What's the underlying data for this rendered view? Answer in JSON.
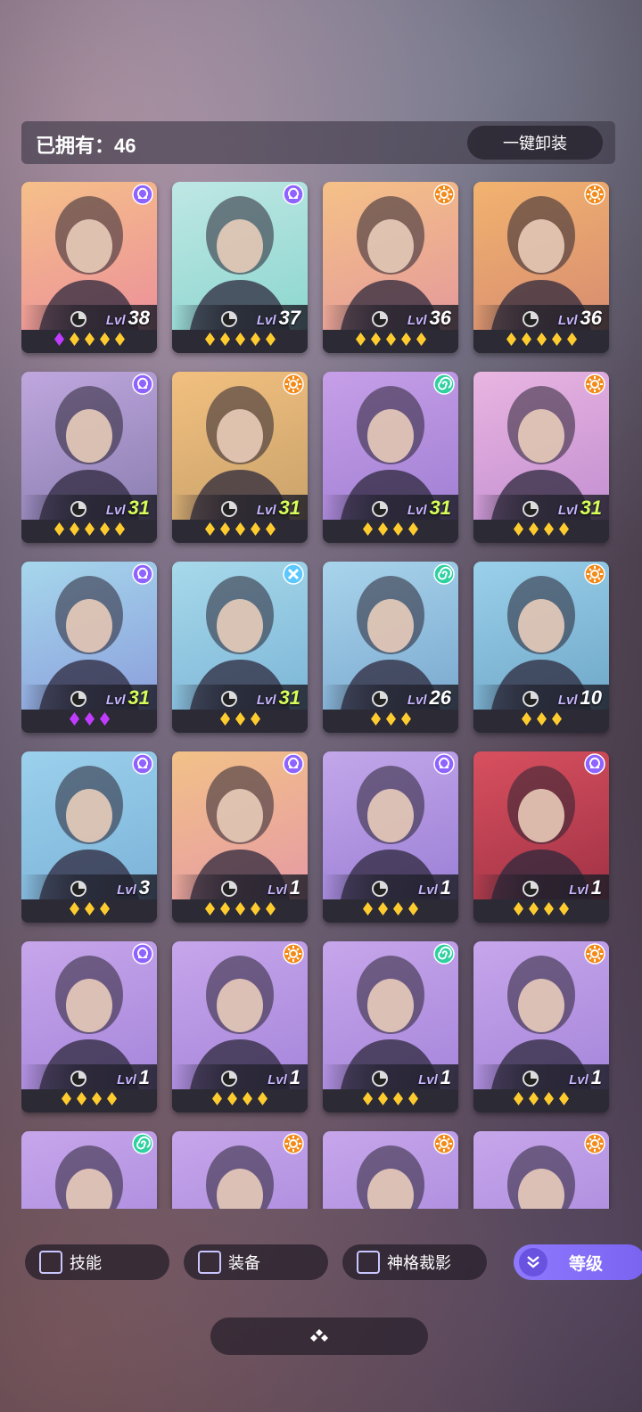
{
  "header": {
    "owned_label": "已拥有：46",
    "unequip_label": "一键卸装"
  },
  "heroes": [
    {
      "level": "38",
      "stars": 5,
      "faction": "omega",
      "bg": [
        "#f5c089",
        "#ec8f9a"
      ]
    },
    {
      "level": "37",
      "stars": 5,
      "faction": "omega",
      "bg": [
        "#bfe7e4",
        "#8cd6cf"
      ]
    },
    {
      "level": "36",
      "stars": 5,
      "faction": "sun",
      "bg": [
        "#f5c187",
        "#e4999b"
      ]
    },
    {
      "level": "36",
      "stars": 5,
      "faction": "sun",
      "bg": [
        "#f2b36f",
        "#d78c70"
      ]
    },
    {
      "level": "31",
      "stars": 5,
      "faction": "omega",
      "bg": [
        "#bfa7de",
        "#8b7eb1"
      ]
    },
    {
      "level": "31",
      "stars": 5,
      "faction": "sun",
      "bg": [
        "#f2c07f",
        "#c9a26b"
      ]
    },
    {
      "level": "31",
      "stars": 4,
      "faction": "spiral",
      "bg": [
        "#c79fe8",
        "#a07fd3"
      ]
    },
    {
      "level": "31",
      "stars": 4,
      "faction": "sun",
      "bg": [
        "#e9b5e1",
        "#c38fd1"
      ]
    },
    {
      "level": "31",
      "stars": 3,
      "faction": "omega",
      "bg": [
        "#a6d7ec",
        "#8b9edc"
      ]
    },
    {
      "level": "31",
      "stars": 3,
      "faction": "cross",
      "bg": [
        "#a7d9ea",
        "#7cb5d7"
      ]
    },
    {
      "level": "26",
      "stars": 3,
      "faction": "spiral",
      "bg": [
        "#a9d4ec",
        "#7aa9cf"
      ]
    },
    {
      "level": "10",
      "stars": 3,
      "faction": "sun",
      "bg": [
        "#9ad0ea",
        "#6fa7c8"
      ]
    },
    {
      "level": "3",
      "stars": 3,
      "faction": "omega",
      "bg": [
        "#9bd1ec",
        "#7cb2d8"
      ]
    },
    {
      "level": "1",
      "stars": 5,
      "faction": "omega",
      "bg": [
        "#f2c188",
        "#e69aa4"
      ]
    },
    {
      "level": "1",
      "stars": 4,
      "faction": "omega",
      "bg": [
        "#c3a7ea",
        "#9b7fd6"
      ]
    },
    {
      "level": "1",
      "stars": 4,
      "faction": "omega",
      "bg": [
        "#d8505f",
        "#a03245"
      ]
    },
    {
      "level": "1",
      "stars": 4,
      "faction": "omega",
      "bg": [
        "#c7a6eb",
        "#a585da"
      ]
    },
    {
      "level": "1",
      "stars": 4,
      "faction": "sun",
      "bg": [
        "#c7a6eb",
        "#a585da"
      ]
    },
    {
      "level": "1",
      "stars": 4,
      "faction": "spiral",
      "bg": [
        "#c7a6eb",
        "#a585da"
      ]
    },
    {
      "level": "1",
      "stars": 4,
      "faction": "sun",
      "bg": [
        "#c7a6eb",
        "#a585da"
      ]
    },
    {
      "level": "",
      "stars": 0,
      "faction": "spiral",
      "bg": [
        "#c7a6eb",
        "#a585da"
      ]
    },
    {
      "level": "",
      "stars": 0,
      "faction": "sun",
      "bg": [
        "#c7a6eb",
        "#a585da"
      ]
    },
    {
      "level": "",
      "stars": 0,
      "faction": "sun",
      "bg": [
        "#c7a6eb",
        "#a585da"
      ]
    },
    {
      "level": "",
      "stars": 0,
      "faction": "sun",
      "bg": [
        "#c7a6eb",
        "#a585da"
      ]
    }
  ],
  "level_prefix": "Lvl",
  "filters": [
    {
      "label": "技能"
    },
    {
      "label": "装备"
    },
    {
      "label": "神格裁影"
    }
  ],
  "sort": {
    "label": "等级"
  },
  "colors": {
    "omega": "#8f63ff",
    "sun": "#f28a1a",
    "spiral": "#2ed1a0",
    "cross": "#5cc8ff",
    "star": "#ffcc2f",
    "purple_star": "#c13cff"
  }
}
